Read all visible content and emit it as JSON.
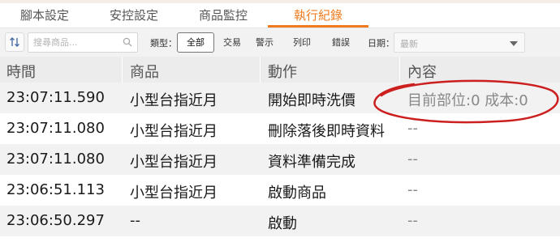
{
  "tabs": [
    {
      "label": "腳本設定",
      "active": false
    },
    {
      "label": "安控設定",
      "active": false
    },
    {
      "label": "商品監控",
      "active": false
    },
    {
      "label": "執行紀錄",
      "active": true
    }
  ],
  "toolbar": {
    "sort_icon": "sort-arrows-icon",
    "search_placeholder": "搜尋商品...",
    "search_icon": "search-icon",
    "type_label": "類型：",
    "filters": [
      {
        "label": "全部",
        "active": true
      },
      {
        "label": "交易",
        "active": false
      },
      {
        "label": "警示",
        "active": false
      },
      {
        "label": "列印",
        "active": false
      },
      {
        "label": "錯誤",
        "active": false
      }
    ],
    "date_label": "日期：",
    "date_value": "最新"
  },
  "table": {
    "columns": [
      "時間",
      "商品",
      "動作",
      "內容"
    ],
    "rows": [
      [
        "23:07:11.590",
        "小型台指近月",
        "開始即時洗價",
        "目前部位:0 成本:0"
      ],
      [
        "23:07:11.080",
        "小型台指近月",
        "刪除落後即時資料",
        "--"
      ],
      [
        "23:07:11.080",
        "小型台指近月",
        "資料準備完成",
        "--"
      ],
      [
        "23:06:51.113",
        "小型台指近月",
        "啟動商品",
        "--"
      ],
      [
        "23:06:50.297",
        "--",
        "啟動",
        "--"
      ]
    ]
  },
  "colors": {
    "accent": "#f07b1e",
    "annotation": "#cc1f1f",
    "header_bg": "#ececec",
    "alt_row_bg": "#f2f2f2"
  }
}
